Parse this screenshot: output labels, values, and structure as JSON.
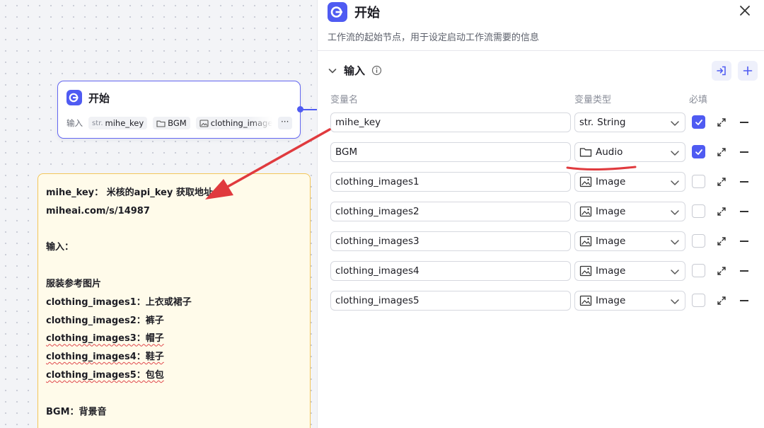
{
  "node": {
    "title": "开始",
    "inputs_label": "输入",
    "chips": [
      {
        "prefix": "str.",
        "label": "mihe_key",
        "icon": "string-icon"
      },
      {
        "label": "BGM",
        "icon": "folder-icon"
      },
      {
        "label": "clothing_images",
        "icon": "image-icon"
      }
    ],
    "more": "···"
  },
  "note": {
    "lines": [
      "mihe_key： 米核的api_key 获取地址",
      "miheai.com/s/14987",
      "",
      "输入：",
      "",
      "服装参考图片",
      "clothing_images1：上衣或裙子",
      "clothing_images2：裤子",
      "clothing_images3：帽子",
      "clothing_images4：鞋子",
      "clothing_images5：包包",
      "",
      "BGM：背景音"
    ]
  },
  "panel": {
    "title": "开始",
    "description": "工作流的起始节点，用于设定启动工作流需要的信息",
    "section_title": "输入",
    "columns": {
      "name": "变量名",
      "type": "变量类型",
      "required": "必填"
    },
    "rows": [
      {
        "name": "mihe_key",
        "type": "String",
        "type_prefix": "str.",
        "type_icon": "string-icon",
        "required": true
      },
      {
        "name": "BGM",
        "type": "Audio",
        "type_icon": "folder-icon",
        "required": true
      },
      {
        "name": "clothing_images1",
        "type": "Image",
        "type_icon": "image-icon",
        "required": false
      },
      {
        "name": "clothing_images2",
        "type": "Image",
        "type_icon": "image-icon",
        "required": false
      },
      {
        "name": "clothing_images3",
        "type": "Image",
        "type_icon": "image-icon",
        "required": false
      },
      {
        "name": "clothing_images4",
        "type": "Image",
        "type_icon": "image-icon",
        "required": false
      },
      {
        "name": "clothing_images5",
        "type": "Image",
        "type_icon": "image-icon",
        "required": false
      }
    ]
  },
  "colors": {
    "accent": "#4f5bf2",
    "node_border": "#6366f1",
    "note_bg": "#fffbea",
    "note_border": "#f3c659",
    "annotation_red": "#e03a3e"
  }
}
